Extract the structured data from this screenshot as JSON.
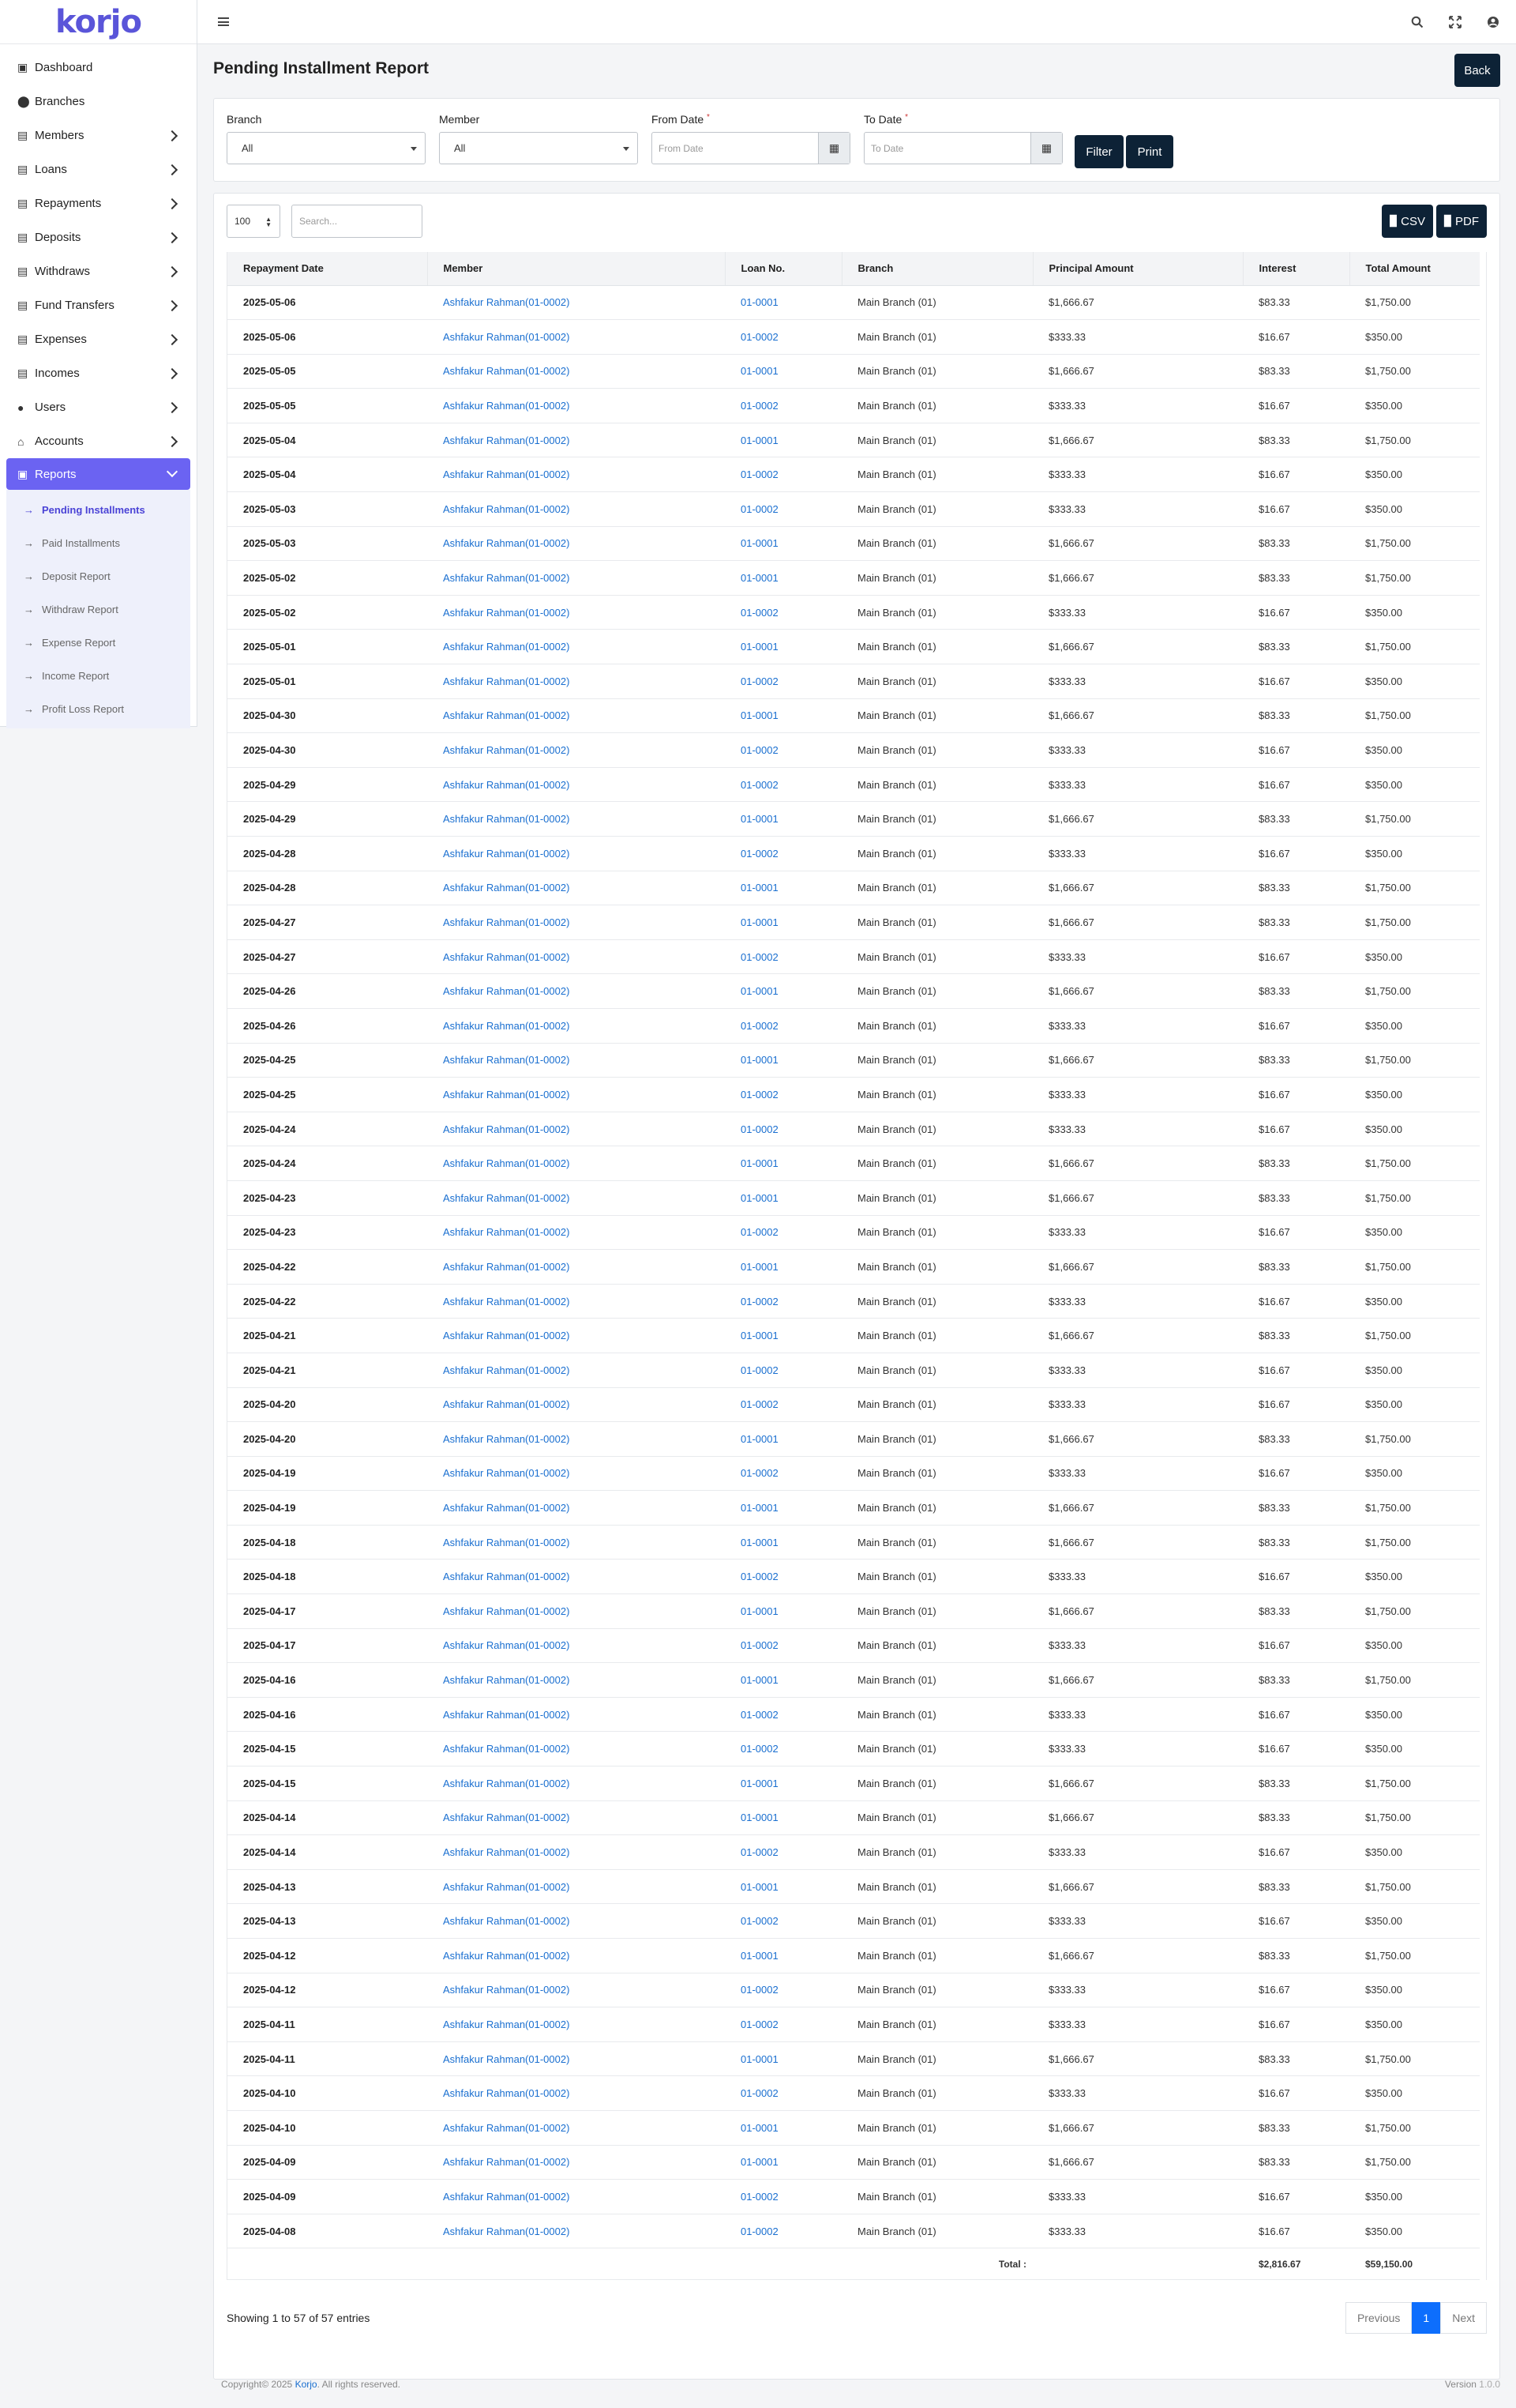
{
  "app": {
    "logo": "korjo"
  },
  "sidebar": {
    "items": [
      {
        "label": "Dashboard",
        "icon": "dashboard-icon",
        "glyph": "▣",
        "chevron": false
      },
      {
        "label": "Branches",
        "icon": "map-pin-icon",
        "glyph": "⬤",
        "chevron": false
      },
      {
        "label": "Members",
        "icon": "member-card-icon",
        "glyph": "▤",
        "chevron": true
      },
      {
        "label": "Loans",
        "icon": "loan-icon",
        "glyph": "▤",
        "chevron": true
      },
      {
        "label": "Repayments",
        "icon": "repayment-icon",
        "glyph": "▤",
        "chevron": true
      },
      {
        "label": "Deposits",
        "icon": "deposit-icon",
        "glyph": "▤",
        "chevron": true
      },
      {
        "label": "Withdraws",
        "icon": "withdraw-icon",
        "glyph": "▤",
        "chevron": true
      },
      {
        "label": "Fund Transfers",
        "icon": "fund-transfer-icon",
        "glyph": "▤",
        "chevron": true
      },
      {
        "label": "Expenses",
        "icon": "expense-icon",
        "glyph": "▤",
        "chevron": true
      },
      {
        "label": "Incomes",
        "icon": "income-icon",
        "glyph": "▤",
        "chevron": true
      },
      {
        "label": "Users",
        "icon": "user-icon",
        "glyph": "●",
        "chevron": true
      },
      {
        "label": "Accounts",
        "icon": "bank-icon",
        "glyph": "⌂",
        "chevron": true
      },
      {
        "label": "Reports",
        "icon": "report-icon",
        "glyph": "▣",
        "chevron": true,
        "active": true
      }
    ],
    "reports_sub": [
      {
        "label": "Pending Installments",
        "active": true
      },
      {
        "label": "Paid Installments"
      },
      {
        "label": "Deposit Report"
      },
      {
        "label": "Withdraw Report"
      },
      {
        "label": "Expense Report"
      },
      {
        "label": "Income Report"
      },
      {
        "label": "Profit Loss Report"
      }
    ]
  },
  "header": {
    "title": "Pending Installment Report",
    "back_label": "Back"
  },
  "filters": {
    "branch_label": "Branch",
    "branch_value": "All",
    "member_label": "Member",
    "member_value": "All",
    "from_label": "From Date",
    "from_placeholder": "From Date",
    "to_label": "To Date",
    "to_placeholder": "To Date",
    "required_mark": "*",
    "filter_label": "Filter",
    "print_label": "Print"
  },
  "table_tools": {
    "page_length": "100",
    "search_placeholder": "Search...",
    "csv_label": "CSV",
    "pdf_label": "PDF"
  },
  "table": {
    "columns": [
      "Repayment Date",
      "Member",
      "Loan No.",
      "Branch",
      "Principal Amount",
      "Interest",
      "Total Amount"
    ],
    "member_name": "Ashfakur Rahman(01-0002)",
    "branch_name": "Main Branch (01)",
    "loans": {
      "01-0001": {
        "principal": "$1,666.67",
        "interest": "$83.33",
        "total": "$1,750.00"
      },
      "01-0002": {
        "principal": "$333.33",
        "interest": "$16.67",
        "total": "$350.00"
      }
    },
    "rows": [
      [
        "2025-05-06",
        "01-0001"
      ],
      [
        "2025-05-06",
        "01-0002"
      ],
      [
        "2025-05-05",
        "01-0001"
      ],
      [
        "2025-05-05",
        "01-0002"
      ],
      [
        "2025-05-04",
        "01-0001"
      ],
      [
        "2025-05-04",
        "01-0002"
      ],
      [
        "2025-05-03",
        "01-0002"
      ],
      [
        "2025-05-03",
        "01-0001"
      ],
      [
        "2025-05-02",
        "01-0001"
      ],
      [
        "2025-05-02",
        "01-0002"
      ],
      [
        "2025-05-01",
        "01-0001"
      ],
      [
        "2025-05-01",
        "01-0002"
      ],
      [
        "2025-04-30",
        "01-0001"
      ],
      [
        "2025-04-30",
        "01-0002"
      ],
      [
        "2025-04-29",
        "01-0002"
      ],
      [
        "2025-04-29",
        "01-0001"
      ],
      [
        "2025-04-28",
        "01-0002"
      ],
      [
        "2025-04-28",
        "01-0001"
      ],
      [
        "2025-04-27",
        "01-0001"
      ],
      [
        "2025-04-27",
        "01-0002"
      ],
      [
        "2025-04-26",
        "01-0001"
      ],
      [
        "2025-04-26",
        "01-0002"
      ],
      [
        "2025-04-25",
        "01-0001"
      ],
      [
        "2025-04-25",
        "01-0002"
      ],
      [
        "2025-04-24",
        "01-0002"
      ],
      [
        "2025-04-24",
        "01-0001"
      ],
      [
        "2025-04-23",
        "01-0001"
      ],
      [
        "2025-04-23",
        "01-0002"
      ],
      [
        "2025-04-22",
        "01-0001"
      ],
      [
        "2025-04-22",
        "01-0002"
      ],
      [
        "2025-04-21",
        "01-0001"
      ],
      [
        "2025-04-21",
        "01-0002"
      ],
      [
        "2025-04-20",
        "01-0002"
      ],
      [
        "2025-04-20",
        "01-0001"
      ],
      [
        "2025-04-19",
        "01-0002"
      ],
      [
        "2025-04-19",
        "01-0001"
      ],
      [
        "2025-04-18",
        "01-0001"
      ],
      [
        "2025-04-18",
        "01-0002"
      ],
      [
        "2025-04-17",
        "01-0001"
      ],
      [
        "2025-04-17",
        "01-0002"
      ],
      [
        "2025-04-16",
        "01-0001"
      ],
      [
        "2025-04-16",
        "01-0002"
      ],
      [
        "2025-04-15",
        "01-0002"
      ],
      [
        "2025-04-15",
        "01-0001"
      ],
      [
        "2025-04-14",
        "01-0001"
      ],
      [
        "2025-04-14",
        "01-0002"
      ],
      [
        "2025-04-13",
        "01-0001"
      ],
      [
        "2025-04-13",
        "01-0002"
      ],
      [
        "2025-04-12",
        "01-0001"
      ],
      [
        "2025-04-12",
        "01-0002"
      ],
      [
        "2025-04-11",
        "01-0002"
      ],
      [
        "2025-04-11",
        "01-0001"
      ],
      [
        "2025-04-10",
        "01-0002"
      ],
      [
        "2025-04-10",
        "01-0001"
      ],
      [
        "2025-04-09",
        "01-0001"
      ],
      [
        "2025-04-09",
        "01-0002"
      ],
      [
        "2025-04-08",
        "01-0002"
      ]
    ],
    "total_label": "Total :",
    "total_interest": "$2,816.67",
    "total_amount": "$59,150.00"
  },
  "pagination": {
    "showing": "Showing 1 to 57 of 57 entries",
    "previous": "Previous",
    "current": "1",
    "next": "Next"
  },
  "footer": {
    "prefix": "Copyright© 2025",
    "brand": "Korjo",
    "suffix": ". All rights reserved.",
    "version_label": "Version",
    "version": "1.0.0"
  }
}
